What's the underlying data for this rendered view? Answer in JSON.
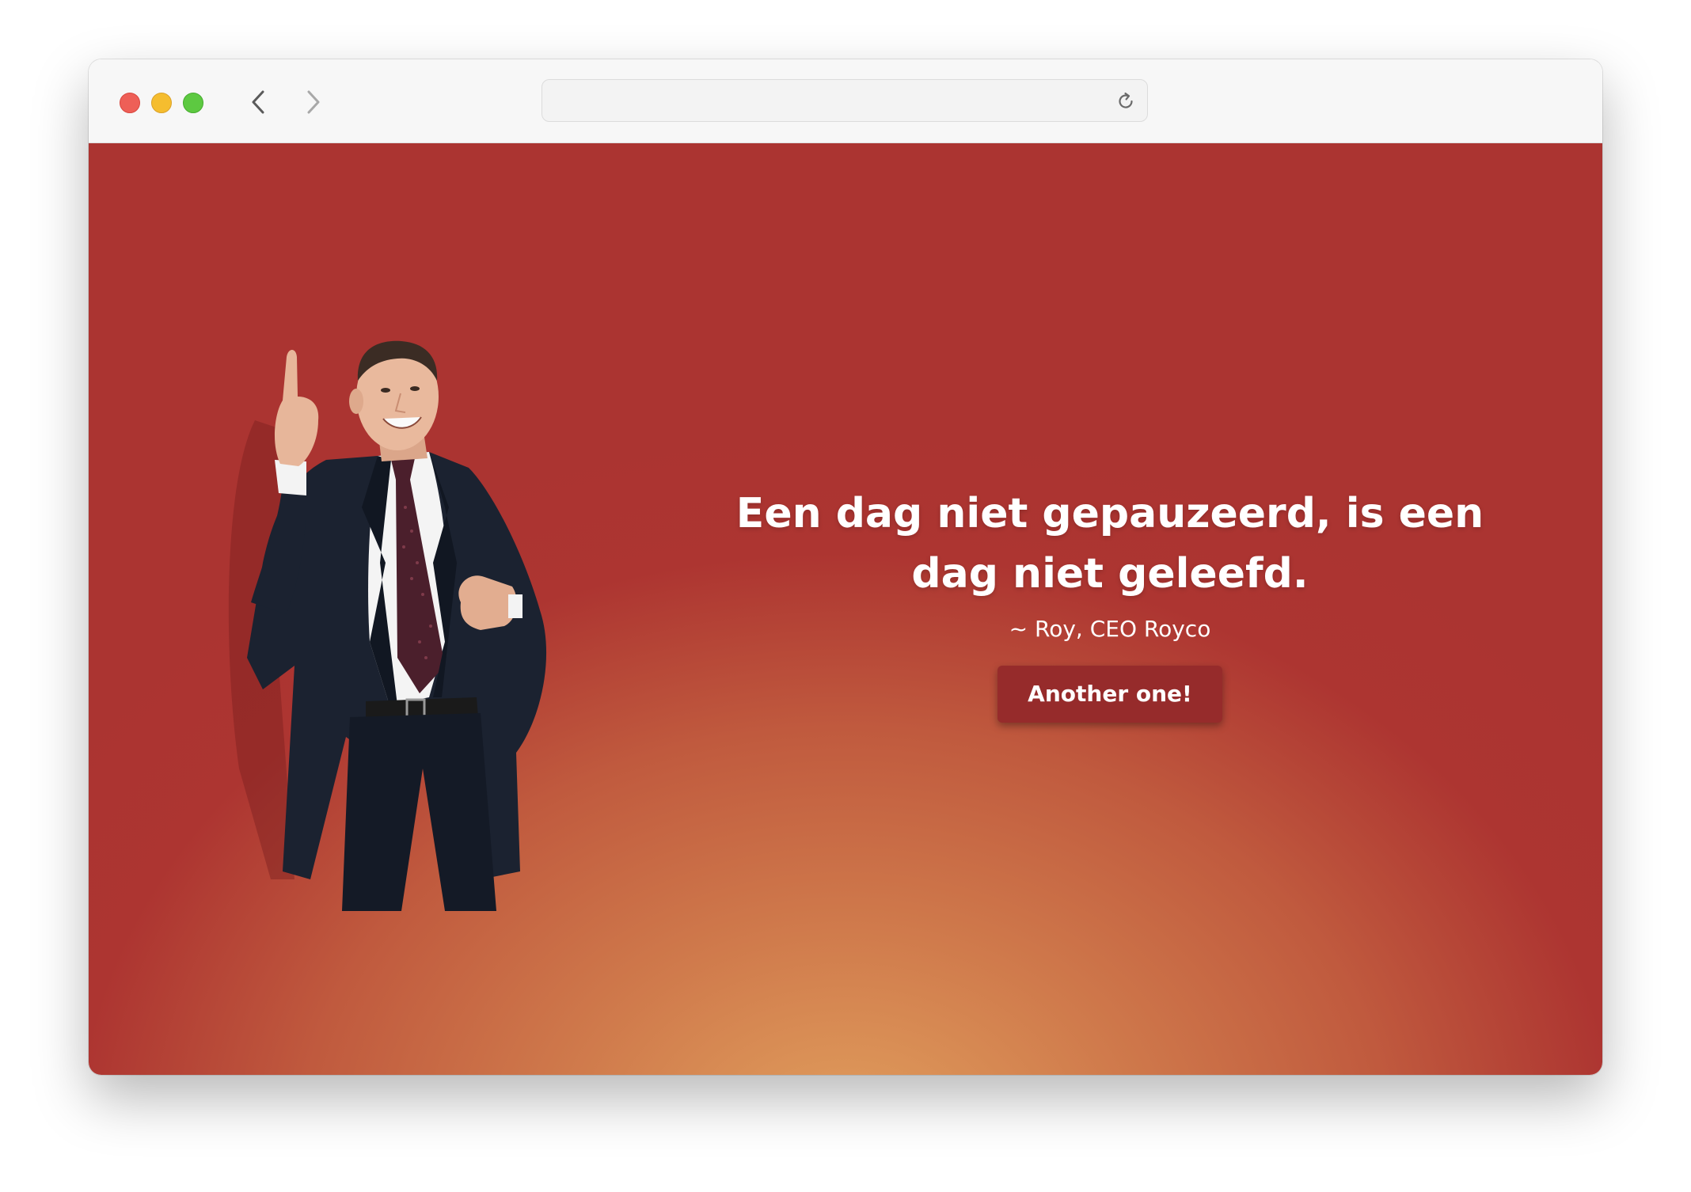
{
  "browser": {
    "url": "",
    "icons": {
      "back": "chevron-left-icon",
      "forward": "chevron-right-icon",
      "reload": "reload-icon"
    }
  },
  "page": {
    "quote": "Een dag niet gepauzeerd, is een dag niet geleefd.",
    "author": "~ Roy, CEO Royco",
    "button_label": "Another one!",
    "colors": {
      "background_edge": "#ab3431",
      "background_center": "#e2a15e",
      "button": "#962b2b",
      "text": "#ffffff"
    }
  }
}
